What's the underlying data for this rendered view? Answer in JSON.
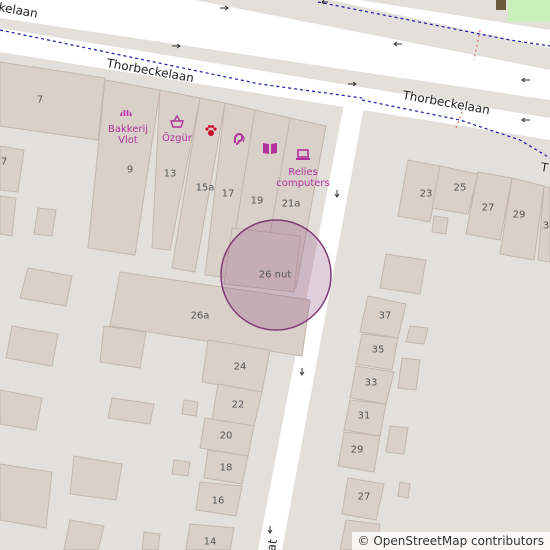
{
  "streets": {
    "thorbeckelaan_top": "kelaan",
    "thorbeckelaan_mid": "Thorbeckelaan",
    "thorbeckelaan_right": "Thorbeckelaan",
    "street_bottom": "at",
    "street_right_edge": "T"
  },
  "house_numbers": {
    "n7": "7",
    "n7b": "7",
    "n9": "9",
    "n13": "13",
    "n15a": "15a",
    "n17": "17",
    "n19": "19",
    "n21a": "21a",
    "n26nut": "26 nut",
    "n26a": "26a",
    "n24": "24",
    "n22": "22",
    "n20": "20",
    "n18": "18",
    "n16": "16",
    "n14": "14",
    "n23": "23",
    "n25": "25",
    "n27r": "27",
    "n29r": "29",
    "n3": "3",
    "n37": "37",
    "n35": "35",
    "n33": "33",
    "n31": "31",
    "n29": "29",
    "n27": "27"
  },
  "pois": {
    "bakkerij_line1": "Bakkerij",
    "bakkerij_line2": "Vlot",
    "ozgur": "Özgür",
    "relies_line1": "Relies",
    "relies_line2": "computers"
  },
  "icons": [
    "bakery-icon",
    "shopping-basket-icon",
    "paw-icon",
    "hearing-aid-icon",
    "book-icon",
    "computer-icon",
    "one-way-arrow-icon"
  ],
  "attribution": "© OpenStreetMap contributors",
  "colors": {
    "building": "#d9d0c9",
    "building_stroke": "#c4b6ab",
    "road": "#ffffff",
    "background": "#e3e0dc",
    "poi": "#b0339c",
    "highlight_fill": "rgba(146,80,130,0.28)",
    "highlight_stroke": "#7e3b73",
    "boundary": "#1a1aa0",
    "green": "#c8f0b8"
  }
}
